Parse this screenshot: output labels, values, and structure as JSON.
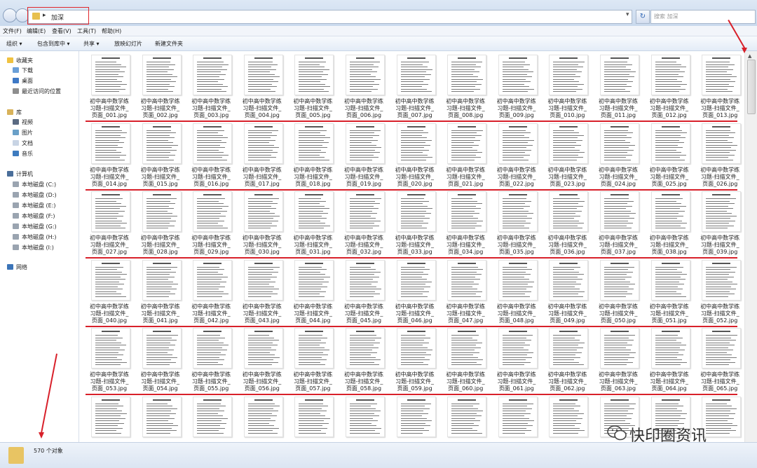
{
  "address": {
    "crumb": "加深"
  },
  "search": {
    "placeholder": "搜索 加深"
  },
  "menu": [
    "文件(F)",
    "编辑(E)",
    "查看(V)",
    "工具(T)",
    "帮助(H)"
  ],
  "toolbar": [
    "组织 ▾",
    "包含到库中 ▾",
    "共享 ▾",
    "放映幻灯片",
    "新建文件夹"
  ],
  "sidebar": {
    "favorites": "收藏夹",
    "fav_items": [
      "下载",
      "桌面",
      "最近访问的位置"
    ],
    "libraries": "库",
    "lib_items": [
      "视频",
      "图片",
      "文档",
      "音乐"
    ],
    "computer": "计算机",
    "drives": [
      "本地磁盘 (C:)",
      "本地磁盘 (D:)",
      "本地磁盘 (E:)",
      "本地磁盘 (F:)",
      "本地磁盘 (G:)",
      "本地磁盘 (H:)",
      "本地磁盘 (I:)"
    ],
    "network": "网络"
  },
  "files": {
    "caption_line1": "初中高中数学练",
    "caption_line2": "习题-扫描文件_",
    "prefix": "页面_",
    "ext": ".jpg",
    "visible_labeled_count": 65
  },
  "status": {
    "count": "570 个对象"
  },
  "brand": "快印圈资讯",
  "colors": {
    "accent_red": "#d8202a",
    "folder": "#e7c04e"
  }
}
